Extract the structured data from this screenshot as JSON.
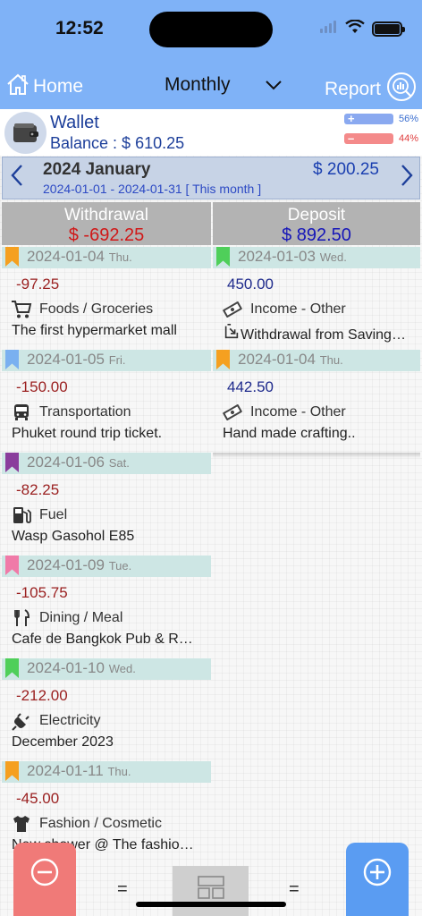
{
  "status_bar": {
    "time": "12:52"
  },
  "nav": {
    "home_label": "Home",
    "period_label": "Monthly",
    "report_label": "Report"
  },
  "wallet": {
    "name": "Wallet",
    "balance_text": "Balance : $ 610.25",
    "income_percent": "56%",
    "expense_percent": "44%",
    "income_color": "#8aa9f0",
    "expense_color": "#f48a8a"
  },
  "month": {
    "title": "2024 January",
    "total": "$ 200.25",
    "range": "2024-01-01 - 2024-01-31 [ This month ]"
  },
  "withdrawal": {
    "title": "Withdrawal",
    "total": "$ -692.25",
    "entries": [
      {
        "date": "2024-01-04",
        "dow": "Thu.",
        "bookmark_color": "#f5a020",
        "amount": "-97.25",
        "category": "Foods / Groceries",
        "icon": "cart-icon",
        "note": "The first hypermarket mall"
      },
      {
        "date": "2024-01-05",
        "dow": "Fri.",
        "bookmark_color": "#7ab0f0",
        "amount": "-150.00",
        "category": "Transportation",
        "icon": "bus-icon",
        "note": "Phuket round trip ticket."
      },
      {
        "date": "2024-01-06",
        "dow": "Sat.",
        "bookmark_color": "#8a3d9c",
        "amount": "-82.25",
        "category": "Fuel",
        "icon": "fuel-icon",
        "note": "Wasp Gasohol E85"
      },
      {
        "date": "2024-01-09",
        "dow": "Tue.",
        "bookmark_color": "#f07aa8",
        "amount": "-105.75",
        "category": "Dining / Meal",
        "icon": "fork-knife-icon",
        "note": "Cafe de Bangkok Pub & R…"
      },
      {
        "date": "2024-01-10",
        "dow": "Wed.",
        "bookmark_color": "#4fcf5a",
        "amount": "-212.00",
        "category": "Electricity",
        "icon": "plug-icon",
        "note": "December 2023"
      },
      {
        "date": "2024-01-11",
        "dow": "Thu.",
        "bookmark_color": "#f5a020",
        "amount": "-45.00",
        "category": "Fashion / Cosmetic",
        "icon": "shirt-icon",
        "note": "New shower @ The fashio…"
      }
    ]
  },
  "deposit": {
    "title": "Deposit",
    "total": "$ 892.50",
    "entries": [
      {
        "date": "2024-01-03",
        "dow": "Wed.",
        "bookmark_color": "#4fcf5a",
        "amount": "450.00",
        "category": "Income - Other",
        "icon": "money-icon",
        "note": "Withdrawal from Saving…",
        "note_icon": "transfer-icon"
      },
      {
        "date": "2024-01-04",
        "dow": "Thu.",
        "bookmark_color": "#f5a020",
        "amount": "442.50",
        "category": "Income - Other",
        "icon": "money-icon",
        "note": "Hand made crafting.."
      }
    ]
  },
  "bottom_bar": {
    "withdraw_icon": "minus-circle-icon",
    "deposit_icon": "plus-circle-icon",
    "layout_icon": "layout-icon",
    "separator": "="
  }
}
